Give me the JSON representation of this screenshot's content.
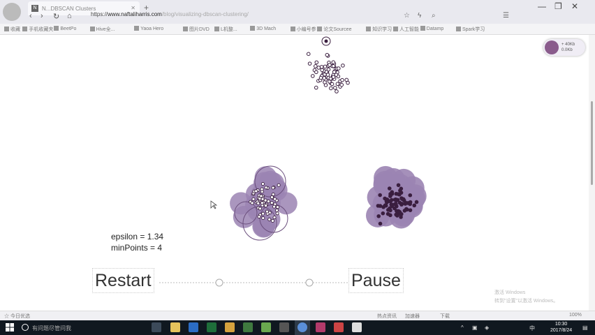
{
  "browser": {
    "tab_title": "N...DBSCAN Clusters",
    "tab_favicon": "N",
    "url_prefix": "https://",
    "url_host": "www.naftaliharris.com",
    "url_path": "/blog/visualizing-dbscan-clustering/",
    "nav_icons": [
      "back-icon",
      "forward-icon",
      "reload-icon",
      "home-icon"
    ],
    "bookmarks": [
      "收藏",
      "手机收藏夹",
      "BeetPo",
      "Hive全...",
      "Yaoa Hero",
      "图片DVD",
      "L机整...",
      "3D Mach",
      "小编号参",
      "论文Sourcee",
      "知识学习",
      "人工智能",
      "Datamp",
      "Spark学习"
    ]
  },
  "page": {
    "epsilon_label": "epsilon = 1.34",
    "minpoints_label": "minPoints = 4",
    "restart_label": "Restart",
    "pause_label": "Pause",
    "ext_line1": "+ 40Kb",
    "ext_line2": "0.0Kb",
    "watermark_line1": "激活 Windows",
    "watermark_line2": "转到\"设置\"以激活 Windows。",
    "cluster_color": "#9b84b3",
    "point_color": "#3a1e3f"
  },
  "statusbar": {
    "left": "☆ 今日优选",
    "right_items": [
      "热点资讯",
      "加速器",
      "下载",
      "100%"
    ]
  },
  "taskbar": {
    "search_placeholder": "有问题尽管问我",
    "clock_time": "10:30",
    "clock_date": "2017/8/24",
    "tray_ime": "中"
  }
}
